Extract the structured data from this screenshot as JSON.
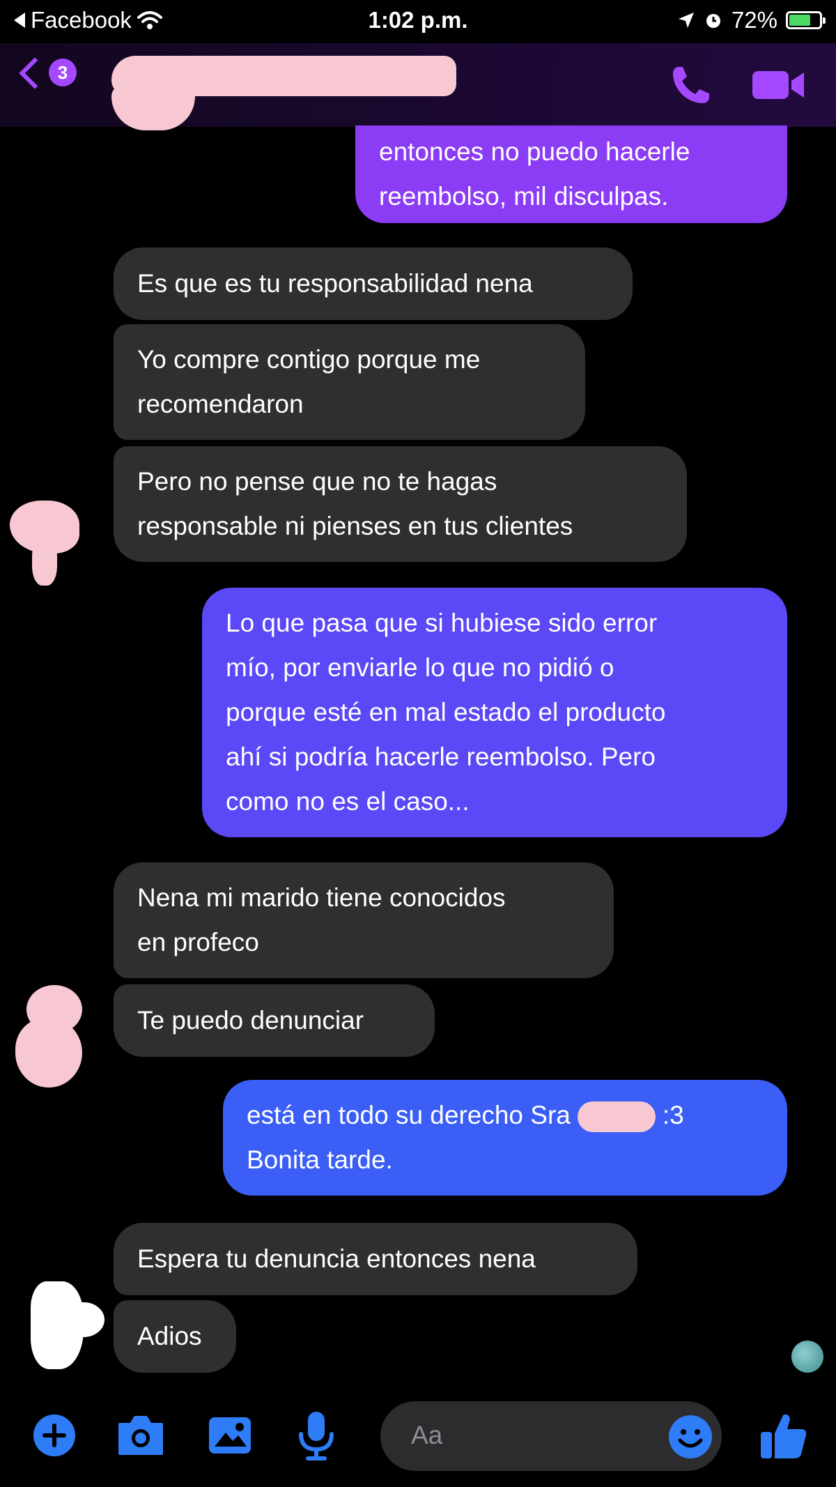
{
  "status_bar": {
    "back_app": "Facebook",
    "time": "1:02 p.m.",
    "battery": "72%",
    "battery_level": 0.72
  },
  "header": {
    "unread_badge": "3"
  },
  "messages": [
    {
      "side": "out",
      "lines": [
        "entonces no puedo hacerle",
        "reembolso, mil disculpas."
      ]
    },
    {
      "side": "in",
      "lines": [
        "Es que es tu responsabilidad nena"
      ]
    },
    {
      "side": "in",
      "lines": [
        "Yo compre contigo porque me",
        "recomendaron"
      ]
    },
    {
      "side": "in",
      "lines": [
        "Pero no pense que no te hagas",
        "responsable ni pienses en tus clientes"
      ]
    },
    {
      "side": "out",
      "lines": [
        "Lo que pasa que si hubiese sido error",
        "mío, por enviarle lo que no pidió o",
        "porque esté en mal estado el producto",
        "ahí si podría hacerle reembolso. Pero",
        "como no es el caso..."
      ]
    },
    {
      "side": "in",
      "lines": [
        "Nena mi marido tiene conocidos",
        "en profeco"
      ]
    },
    {
      "side": "in",
      "lines": [
        "Te puedo denunciar"
      ]
    },
    {
      "side": "out",
      "lines": [
        "está en todo su derecho Sra",
        "Bonita tarde."
      ],
      "suffix": ":3"
    },
    {
      "side": "in",
      "lines": [
        "Espera tu denuncia entonces nena"
      ]
    },
    {
      "side": "in",
      "lines": [
        "Adios"
      ]
    }
  ],
  "composer": {
    "placeholder": "Aa"
  },
  "colors": {
    "accent": "#a449ff",
    "incoming_bubble": "#2f2f31",
    "outgoing_purple": "#8b3cf5",
    "outgoing_indigo": "#5b48f7",
    "outgoing_blue": "#3a5ef6",
    "toolbar_icon": "#2e7cf6"
  },
  "icons": [
    "back-chevron-icon",
    "phone-icon",
    "video-camera-icon",
    "plus-icon",
    "camera-icon",
    "image-icon",
    "microphone-icon",
    "emoji-icon",
    "thumbs-up-icon",
    "wifi-icon",
    "location-arrow-icon",
    "alarm-icon"
  ]
}
